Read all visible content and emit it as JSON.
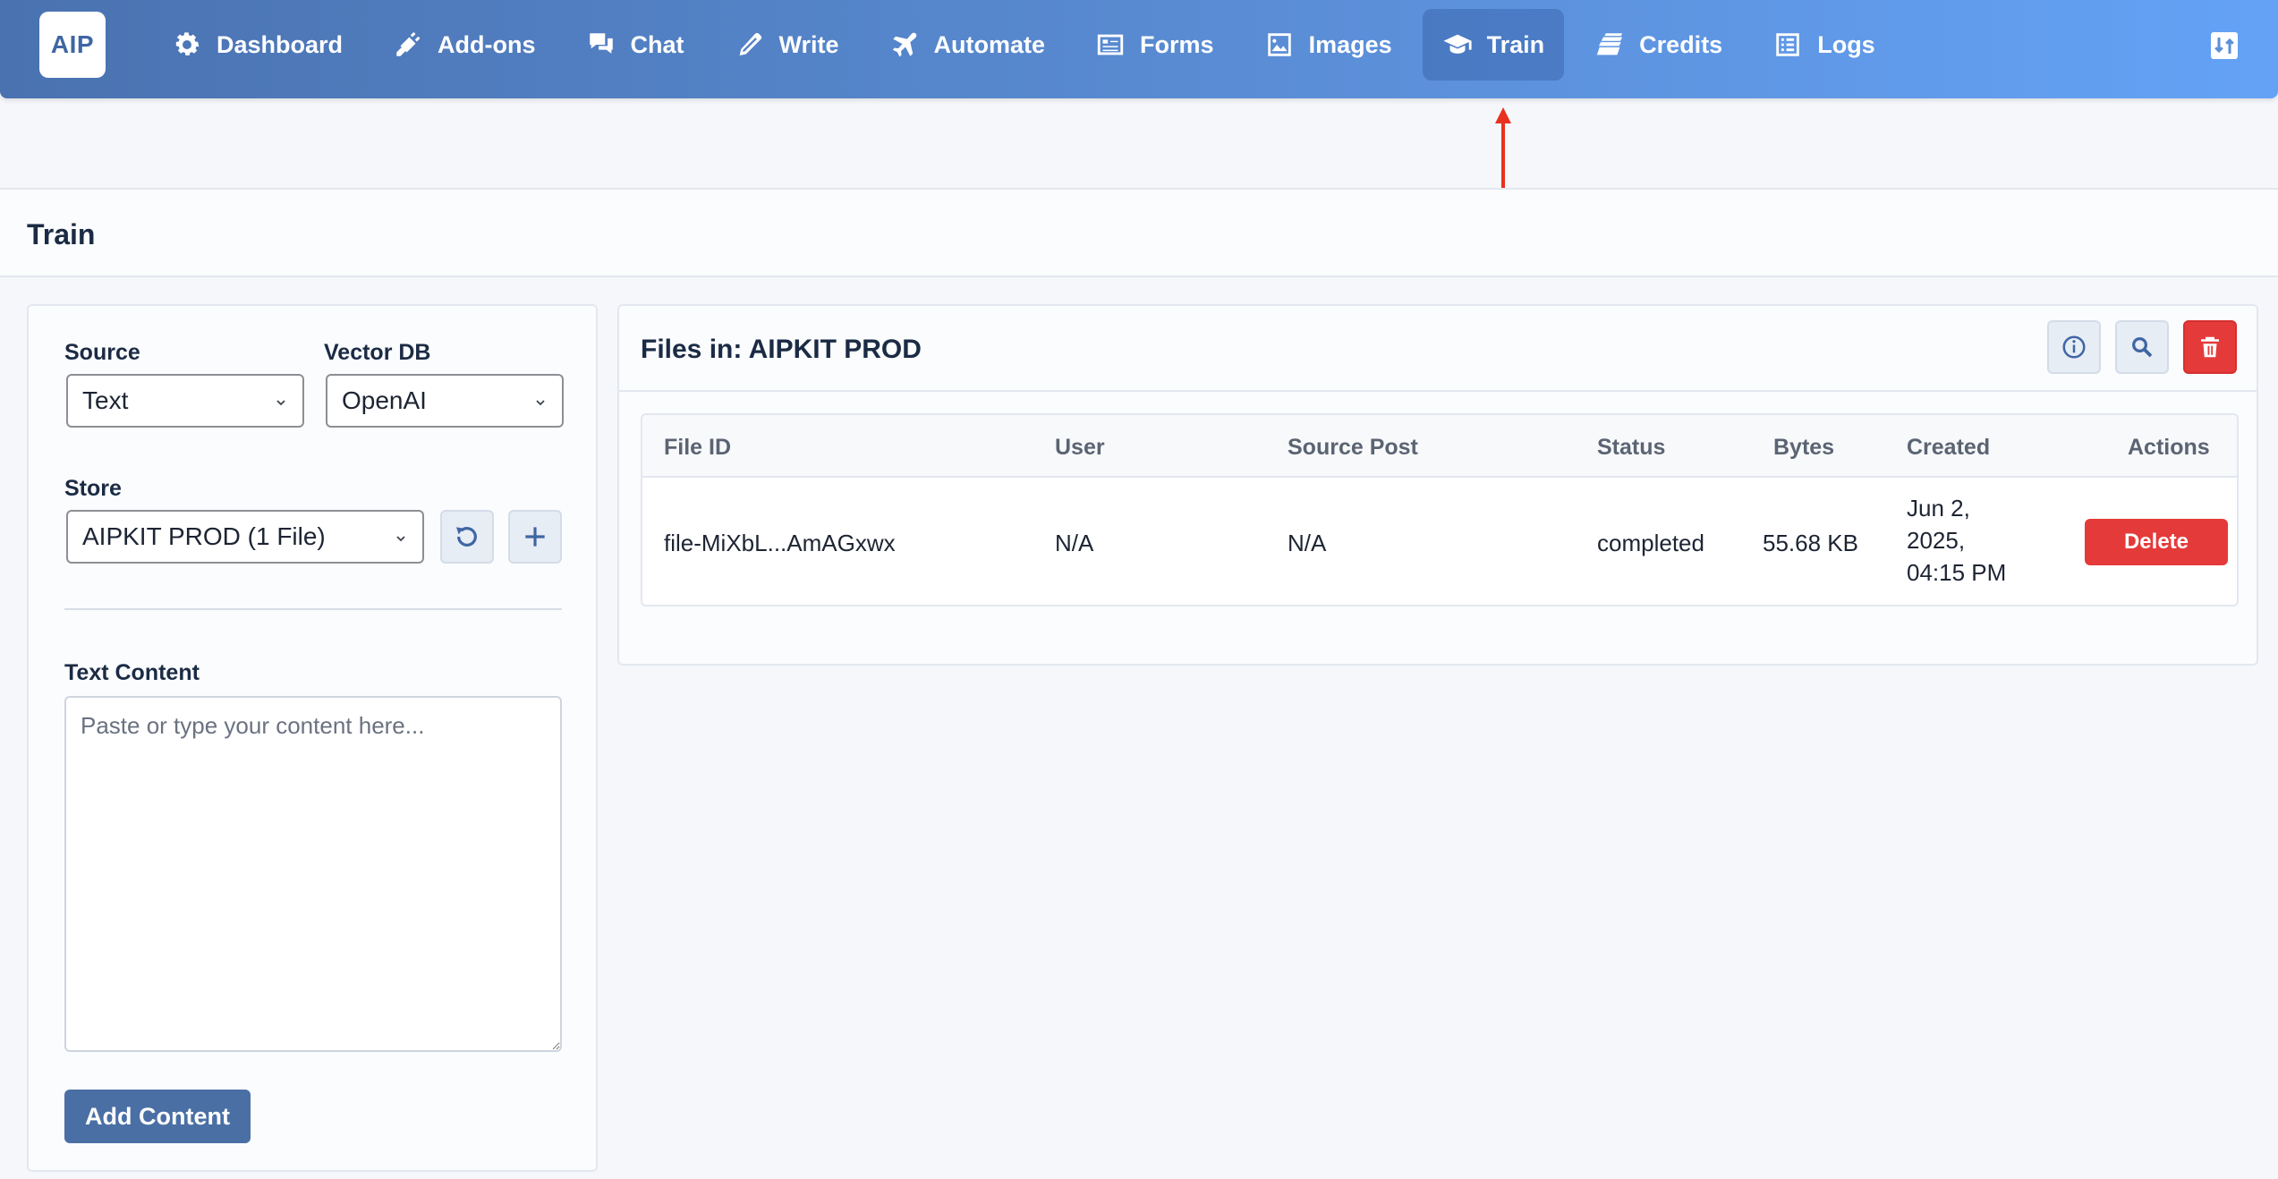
{
  "app": {
    "logo_text": "AIP"
  },
  "nav": {
    "items": [
      {
        "label": "Dashboard",
        "icon": "gear-icon"
      },
      {
        "label": "Add-ons",
        "icon": "plug-icon"
      },
      {
        "label": "Chat",
        "icon": "chat-bubbles-icon"
      },
      {
        "label": "Write",
        "icon": "pencil-icon"
      },
      {
        "label": "Automate",
        "icon": "plane-icon"
      },
      {
        "label": "Forms",
        "icon": "form-icon"
      },
      {
        "label": "Images",
        "icon": "image-icon"
      },
      {
        "label": "Train",
        "icon": "graduation-cap-icon",
        "active": true
      },
      {
        "label": "Credits",
        "icon": "money-stack-icon"
      },
      {
        "label": "Logs",
        "icon": "list-icon"
      }
    ],
    "toggle_icon": "sort-toggle-icon"
  },
  "page": {
    "title": "Train"
  },
  "form": {
    "source_label": "Source",
    "source_value": "Text",
    "vector_db_label": "Vector DB",
    "vector_db_value": "OpenAI",
    "store_label": "Store",
    "store_value": "AIPKIT PROD (1 File)",
    "text_content_label": "Text Content",
    "text_content_value": "",
    "text_content_placeholder": "Paste or type your content here...",
    "add_content_label": "Add Content"
  },
  "files": {
    "title": "Files in: AIPKIT PROD",
    "columns": [
      "File ID",
      "User",
      "Source Post",
      "Status",
      "Bytes",
      "Created",
      "Actions"
    ],
    "rows": [
      {
        "file_id": "file-MiXbL...AmAGxwx",
        "user": "N/A",
        "source_post": "N/A",
        "status": "completed",
        "bytes": "55.68 KB",
        "created_line1": "Jun 2,",
        "created_line2": "2025,",
        "created_line3": "04:15 PM",
        "action_label": "Delete"
      }
    ]
  },
  "colors": {
    "nav_gradient_start": "#4a72b0",
    "nav_gradient_end": "#64a2f6",
    "primary": "#4a6fa5",
    "danger": "#e53a3a",
    "annotation_arrow": "#e8321e"
  }
}
